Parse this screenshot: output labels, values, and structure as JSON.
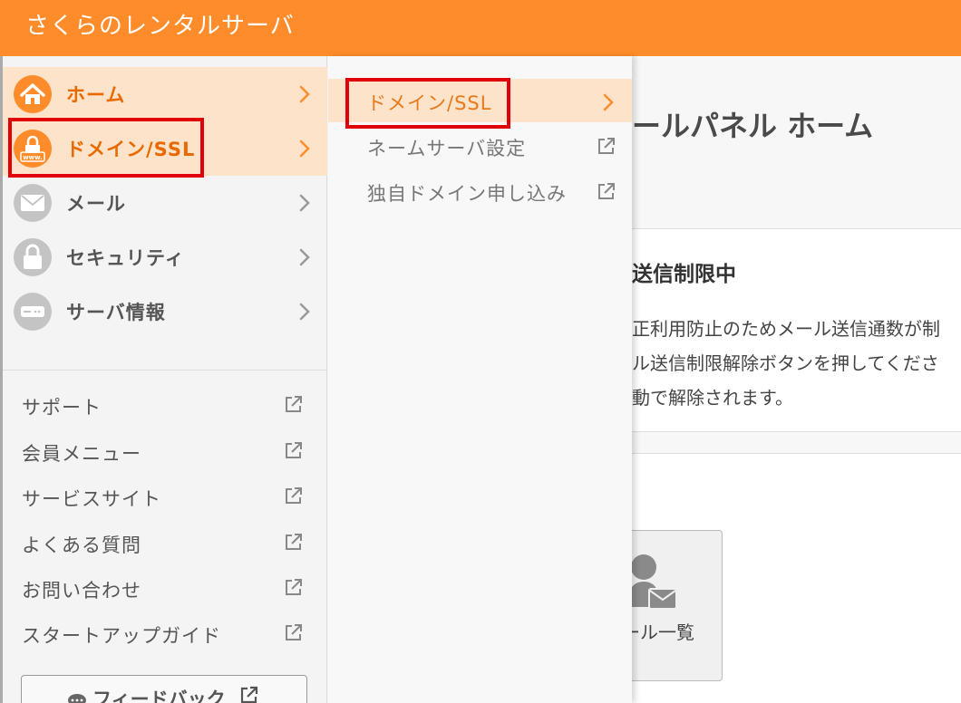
{
  "header": {
    "brand": "さくらのレンタルサーバ"
  },
  "sidebar": {
    "items": [
      {
        "label": "ホーム",
        "icon": "home-icon",
        "active": true
      },
      {
        "label": "ドメイン/SSL",
        "icon": "domain-lock-icon",
        "active": true
      },
      {
        "label": "メール",
        "icon": "mail-icon",
        "active": false
      },
      {
        "label": "セキュリティ",
        "icon": "lock-icon",
        "active": false
      },
      {
        "label": "サーバ情報",
        "icon": "server-icon",
        "active": false
      }
    ],
    "links": [
      {
        "label": "サポート"
      },
      {
        "label": "会員メニュー"
      },
      {
        "label": "サービスサイト"
      },
      {
        "label": "よくある質問"
      },
      {
        "label": "お問い合わせ"
      },
      {
        "label": "スタートアップガイド"
      }
    ],
    "feedback_label": "フィードバック"
  },
  "subpanel": {
    "items": [
      {
        "label": "ドメイン/SSL",
        "type": "section",
        "active": true
      },
      {
        "label": "ネームサーバ設定",
        "type": "external"
      },
      {
        "label": "独自ドメイン申し込み",
        "type": "external"
      }
    ]
  },
  "main": {
    "page_title": "ールパネル ホーム",
    "notice_title": "送信制限中",
    "notice_lines": [
      "正利用防止のためメール送信通数が制",
      "ル送信制限解除ボタンを押してくださ",
      "動で解除されます。"
    ],
    "card_label": "ール一覧"
  },
  "colors": {
    "accent": "#ff8c2a",
    "active_bg": "#fde3c9",
    "highlight": "#e0000a"
  }
}
